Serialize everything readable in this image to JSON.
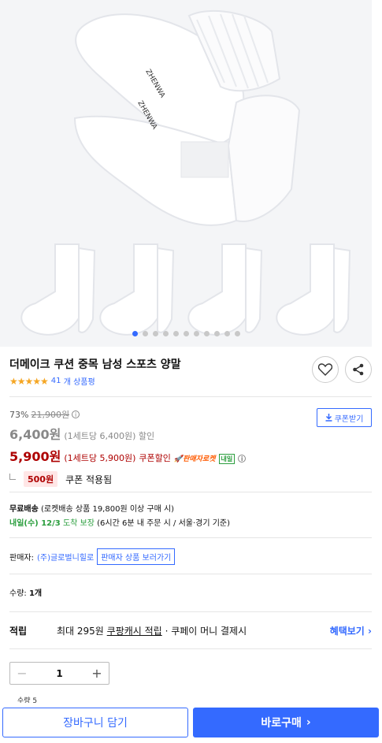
{
  "gallery": {
    "dot_count": 11,
    "active_dot": 0
  },
  "product": {
    "title": "더메이크 쿠션 중목 남성 스포츠 양말",
    "stars": "★★★★★",
    "review_count": "41",
    "review_suffix": "개 상품평"
  },
  "price": {
    "discount_rate": "73%",
    "original_price": "21,900원",
    "sale_price": "6,400원",
    "sale_unit": "(1세트당 6,400원) 할인",
    "coupon_price": "5,900원",
    "coupon_unit": "(1세트당 5,900원)",
    "coupon_label": "쿠폰할인",
    "rocket_label": "🚀판매자로켓",
    "tomorrow_badge": "내일",
    "coupon_button": "쿠폰받기",
    "coupon_amount": "500원",
    "coupon_applied": "쿠폰 적용됨"
  },
  "shipping": {
    "free_label": "무료배송",
    "free_desc": "(로켓배송 상품 19,800원 이상 구매 시)",
    "arrival_label": "내일(수) 12/3",
    "arrival_guarantee": "도착 보장",
    "arrival_desc": "(6시간 6분 내 주문 시 / 서울·경기 기준)"
  },
  "seller": {
    "label": "판매자:",
    "name": "(주)글로벌니힐로",
    "button": "판매자 상품 보러가기"
  },
  "quantity": {
    "label": "수량:",
    "value": "1개"
  },
  "points": {
    "head": "적립",
    "prefix": "최대 295원",
    "link": "쿠팡캐시 적립",
    "suffix": "· 쿠페이 머니 결제시",
    "more": "혜택보기"
  },
  "stepper": {
    "minus": "−",
    "value": "1",
    "plus": "+"
  },
  "peek": "수량 5",
  "actions": {
    "cart": "장바구니 담기",
    "buy": "바로구매"
  },
  "colors": {
    "accent": "#346aff",
    "price_red": "#ae0000",
    "arrival_green": "#2b9e3e",
    "star": "#f5a623"
  }
}
